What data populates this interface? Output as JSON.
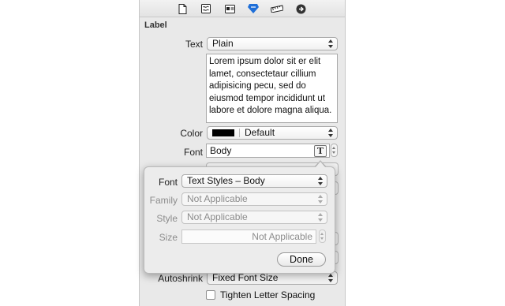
{
  "toolbar": {
    "icons": [
      "file-icon",
      "quick-help-icon",
      "identity-icon",
      "attributes-icon",
      "size-ruler-icon",
      "connections-icon"
    ],
    "active_color": "#1f6fd8"
  },
  "inspector": {
    "section_title": "Label",
    "text_label": "Text",
    "text_value": "Plain",
    "sample_text": "Lorem ipsum dolor sit er elit lamet, consectetaur cillium adipisicing pecu, sed do eiusmod tempor incididunt ut labore et dolore magna aliqua.",
    "color_label": "Color",
    "color_value": "Default",
    "font_label": "Font",
    "font_value": "Body",
    "font_button": "T",
    "autoshrink_label": "Autoshrink",
    "autoshrink_value": "Fixed Font Size",
    "tighten_label": "Tighten Letter Spacing"
  },
  "font_popover": {
    "font_label": "Font",
    "font_value": "Text Styles – Body",
    "family_label": "Family",
    "family_value": "Not Applicable",
    "style_label": "Style",
    "style_value": "Not Applicable",
    "size_label": "Size",
    "size_value": "Not Applicable",
    "done_label": "Done"
  }
}
